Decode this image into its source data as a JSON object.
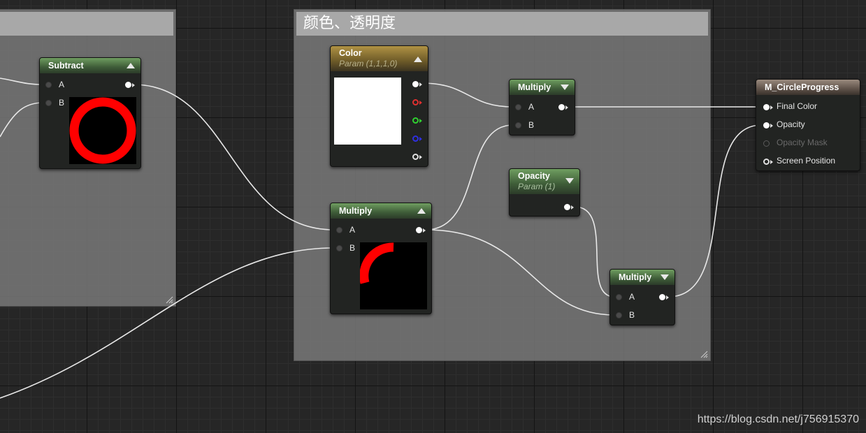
{
  "comments": {
    "left": {
      "title": ""
    },
    "right": {
      "title": "颜色、透明度"
    }
  },
  "nodes": {
    "subtract": {
      "title": "Subtract",
      "pins": {
        "a": "A",
        "b": "B"
      }
    },
    "color_param": {
      "title": "Color",
      "subtitle": "Param (1,1,1,0)",
      "preview_color": "#ffffff"
    },
    "multiply_top": {
      "title": "Multiply",
      "pins": {
        "a": "A",
        "b": "B"
      }
    },
    "multiply_mid": {
      "title": "Multiply",
      "pins": {
        "a": "A",
        "b": "B"
      }
    },
    "opacity_param": {
      "title": "Opacity",
      "subtitle": "Param (1)"
    },
    "multiply_bottom": {
      "title": "Multiply",
      "pins": {
        "a": "A",
        "b": "B"
      }
    },
    "result": {
      "title": "M_CircleProgress",
      "pins": {
        "final_color": "Final Color",
        "opacity": "Opacity",
        "opacity_mask": "Opacity Mask",
        "screen_position": "Screen Position"
      }
    }
  },
  "colors": {
    "preview_red": "#ff0000",
    "wire": "#e8e8e8"
  },
  "watermark": "https://blog.csdn.net/j756915370"
}
